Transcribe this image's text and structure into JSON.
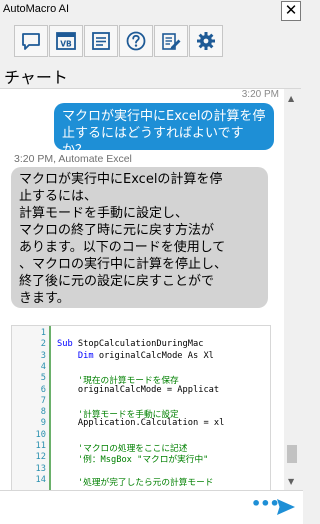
{
  "window": {
    "title": "AutoMacro AI",
    "close_glyph": "✕"
  },
  "toolbar": {
    "buttons": [
      {
        "name": "chat-icon"
      },
      {
        "name": "vb-icon"
      },
      {
        "name": "document-icon"
      },
      {
        "name": "help-icon"
      },
      {
        "name": "edit-checklist-icon"
      },
      {
        "name": "gear-icon"
      }
    ],
    "accent": "#1e5a96"
  },
  "heading": "チャート",
  "chat": {
    "messages": [
      {
        "role": "user",
        "timestamp": "3:20 PM",
        "lines": [
          "マクロが実行中にExcelの計算を停",
          "止するにはどうすればよいですか？"
        ]
      },
      {
        "role": "assistant",
        "timestamp": "3:20 PM, Automate Excel",
        "lines": [
          "マクロが実行中にExcelの計算を停",
          "止するには、",
          "計算モードを手動に設定し、",
          "マクロの終了時に元に戻す方法が",
          "あります。以下のコードを使用して",
          "、マクロの実行中に計算を停止し、",
          "終了後に元の設定に戻すことがで",
          "きます。"
        ]
      }
    ],
    "code": {
      "line_numbers": [
        "1",
        "2",
        "3",
        "4",
        "5",
        "6",
        "7",
        "8",
        "9",
        "10",
        "11",
        "12",
        "13",
        "14"
      ],
      "lines": [
        {
          "kw": "",
          "rest": "",
          "type": "plain"
        },
        {
          "kw": "Sub ",
          "rest": "StopCalculationDuringMac",
          "type": "kw"
        },
        {
          "kw": "    Dim ",
          "rest": "originalCalcMode As Xl",
          "type": "kw"
        },
        {
          "kw": "",
          "rest": "",
          "type": "plain"
        },
        {
          "kw": "",
          "rest": "    '現在の計算モードを保存",
          "type": "cm"
        },
        {
          "kw": "",
          "rest": "    originalCalcMode = Applicat",
          "type": "plain"
        },
        {
          "kw": "",
          "rest": "",
          "type": "plain"
        },
        {
          "kw": "",
          "rest": "    '計算モードを手動に設定",
          "type": "cm"
        },
        {
          "kw": "",
          "rest": "    Application.Calculation = xl",
          "type": "plain"
        },
        {
          "kw": "",
          "rest": "",
          "type": "plain"
        },
        {
          "kw": "",
          "rest": "    'マクロの処理をここに記述",
          "type": "cm"
        },
        {
          "kw": "",
          "rest": "    '例：MsgBox \"マクロが実行中\"",
          "type": "cm"
        },
        {
          "kw": "",
          "rest": "",
          "type": "plain"
        },
        {
          "kw": "",
          "rest": "    '処理が完了したら元の計算モード",
          "type": "cm"
        }
      ]
    }
  },
  "input": {
    "value": "",
    "placeholder": "",
    "more_glyph": "•••"
  },
  "colors": {
    "user_bubble": "#1e8fd6",
    "bot_bubble": "#d3d3d3",
    "keyword": "#0000ff",
    "comment": "#008000",
    "line_number": "#2b91af"
  }
}
